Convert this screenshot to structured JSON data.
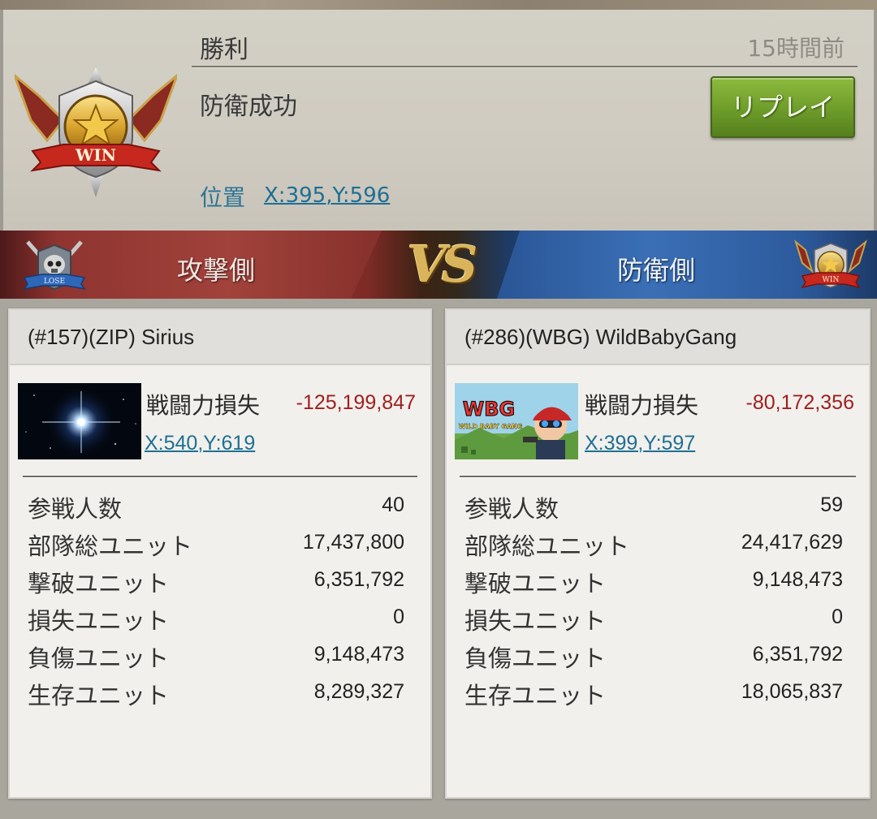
{
  "header": {
    "result_title": "勝利",
    "time_ago": "15時間前",
    "result_subtitle": "防衛成功",
    "replay_label": "リプレイ",
    "location_label": "位置",
    "location_coords": "X:395,Y:596",
    "badge_text": "WIN"
  },
  "versus": {
    "attacker_label": "攻撃側",
    "defender_label": "防衛側",
    "vs_text": "VS",
    "attacker_badge_text": "LOSE",
    "defender_badge_text": "WIN"
  },
  "attacker": {
    "name": "(#157)(ZIP) Sirius",
    "loss_label": "戦闘力損失",
    "loss_value": "-125,199,847",
    "coords": "X:540,Y:619",
    "stats": [
      {
        "label": "参戦人数",
        "value": "40"
      },
      {
        "label": "部隊総ユニット",
        "value": "17,437,800"
      },
      {
        "label": "撃破ユニット",
        "value": "6,351,792"
      },
      {
        "label": "損失ユニット",
        "value": "0"
      },
      {
        "label": "負傷ユニット",
        "value": "9,148,473"
      },
      {
        "label": "生存ユニット",
        "value": "8,289,327"
      }
    ]
  },
  "defender": {
    "name": "(#286)(WBG) WildBabyGang",
    "loss_label": "戦闘力損失",
    "loss_value": "-80,172,356",
    "coords": "X:399,Y:597",
    "avatar_text": "WBG",
    "avatar_subtext": "WILD BABY GANG",
    "stats": [
      {
        "label": "参戦人数",
        "value": "59"
      },
      {
        "label": "部隊総ユニット",
        "value": "24,417,629"
      },
      {
        "label": "撃破ユニット",
        "value": "9,148,473"
      },
      {
        "label": "損失ユニット",
        "value": "0"
      },
      {
        "label": "負傷ユニット",
        "value": "6,351,792"
      },
      {
        "label": "生存ユニット",
        "value": "18,065,837"
      }
    ]
  },
  "colors": {
    "attacker_red": "#9a3a35",
    "defender_blue": "#2d5a9c",
    "replay_green": "#6d9c2a",
    "link_blue": "#1f6f93",
    "loss_red": "#9e1f1f"
  }
}
